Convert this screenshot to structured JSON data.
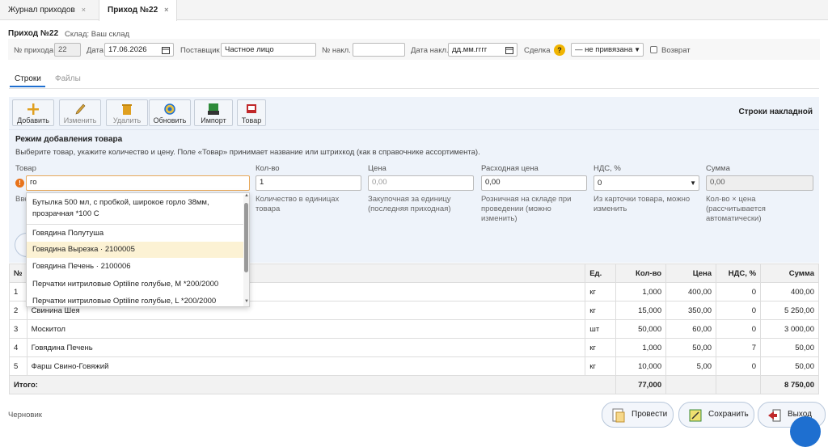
{
  "tabs": [
    {
      "label": "Журнал приходов",
      "close": "×"
    },
    {
      "label": "Приход №22",
      "close": "×"
    }
  ],
  "header": {
    "title": "Приход №22",
    "warehouse": "Склад: Ваш склад",
    "fields": {
      "num_label": "№ прихода",
      "num_value": "22",
      "date_label": "Дата",
      "date_value": "17.06.2026",
      "supplier_label": "Поставщик",
      "supplier_value": "Частное лицо",
      "invoice_label": "№ накл.",
      "invoice_value": "",
      "invoice_date_label": "Дата накл.",
      "invoice_date_value": "дд.мм.гггг",
      "deal_label": "Сделка",
      "deal_help": "?",
      "deal_value": "— не привязана",
      "return_label": "Возврат"
    }
  },
  "subtabs": [
    "Строки",
    "Файлы"
  ],
  "toolbar": {
    "buttons": [
      {
        "label": "Добавить",
        "icon": "plus-icon"
      },
      {
        "label": "Изменить",
        "icon": "pencil-icon"
      },
      {
        "label": "Удалить",
        "icon": "trash-icon"
      },
      {
        "label": "Обновить",
        "icon": "refresh-icon"
      },
      {
        "label": "Импорт",
        "icon": "import-icon"
      },
      {
        "label": "Товар",
        "icon": "product-icon"
      }
    ],
    "right_title": "Строки накладной"
  },
  "add_mode": {
    "title": "Режим добавления товара",
    "description": "Выберите товар, укажите количество и цену. Поле «Товар» принимает название или штрихкод (как в справочнике ассортимента).",
    "product_label": "Товар",
    "product_value": "го",
    "product_hint_partial": "Вве",
    "qty_label": "Кол-во",
    "qty_value": "1",
    "qty_hint": "Количество в единицах товара",
    "price_label": "Цена",
    "price_placeholder": "0,00",
    "price_hint": "Закупочная за единицу (последняя приходная)",
    "retail_label": "Расходная цена",
    "retail_value": "0,00",
    "retail_hint": "Розничная на складе при проведении (можно изменить)",
    "vat_label": "НДС, %",
    "vat_value": "0",
    "vat_hint": "Из карточки товара, можно изменить",
    "sum_label": "Сумма",
    "sum_value": "0,00",
    "sum_hint": "Кол-во × цена (рассчитывается автоматически)"
  },
  "dropdown": [
    "Бутылка 500 мл, с пробкой, широкое горло 38мм, прозрачная *100 С",
    "Говядина Полутуша",
    "Говядина Вырезка · 2100005",
    "Говядина Печень · 2100006",
    "Перчатки нитриловые Optiline голубые, M *200/2000",
    "Перчатки нитриловые Optiline голубые, L *200/2000"
  ],
  "table": {
    "columns": [
      "№",
      "",
      "Ед.",
      "Кол-во",
      "Цена",
      "НДС, %",
      "Сумма"
    ],
    "rows": [
      [
        "1",
        "",
        "кг",
        "1,000",
        "400,00",
        "0",
        "400,00"
      ],
      [
        "2",
        "Свинина Шея",
        "кг",
        "15,000",
        "350,00",
        "0",
        "5 250,00"
      ],
      [
        "3",
        "Москитол",
        "шт",
        "50,000",
        "60,00",
        "0",
        "3 000,00"
      ],
      [
        "4",
        "Говядина Печень",
        "кг",
        "1,000",
        "50,00",
        "7",
        "50,00"
      ],
      [
        "5",
        "Фарш Свино-Говяжий",
        "кг",
        "10,000",
        "5,00",
        "0",
        "50,00"
      ]
    ],
    "total": {
      "label": "Итого:",
      "qty": "77,000",
      "sum": "8 750,00"
    }
  },
  "footer": {
    "status": "Черновик",
    "post": "Провести",
    "save": "Сохранить",
    "exit": "Выход"
  },
  "colors": {
    "accent": "#1e6fd0",
    "highlight": "#fcf2d4",
    "panel": "#eef3fa",
    "warn": "#e8731a",
    "help": "#f0b400"
  }
}
